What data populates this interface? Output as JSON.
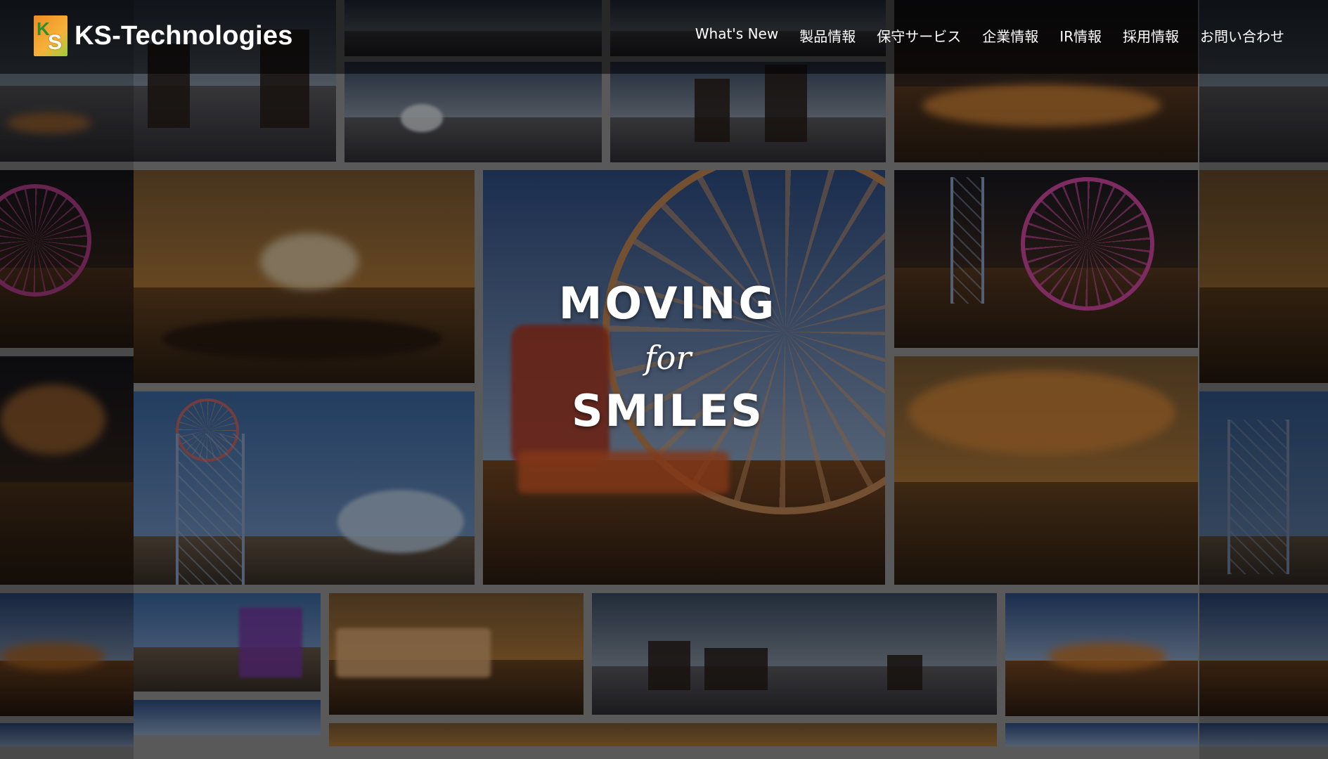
{
  "brand": {
    "name": "KS-Technologies",
    "logo_letters": {
      "top": "K",
      "bottom": "S"
    }
  },
  "nav": {
    "items": [
      {
        "label": "What's New"
      },
      {
        "label": "製品情報"
      },
      {
        "label": "保守サービス"
      },
      {
        "label": "企業情報"
      },
      {
        "label": "IR情報"
      },
      {
        "label": "採用情報"
      },
      {
        "label": "お問い合わせ"
      }
    ]
  },
  "hero": {
    "line1": "MOVING",
    "line2": "for",
    "line3": "SMILES"
  },
  "colors": {
    "accent_orange": "#f08a24",
    "accent_green": "#9bcf3a",
    "header_bg": "rgba(0,0,0,0.55)",
    "text": "#ffffff"
  }
}
